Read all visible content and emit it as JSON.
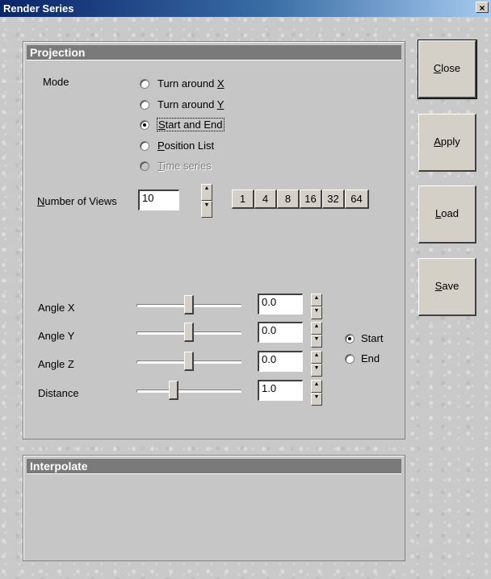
{
  "window": {
    "title": "Render Series",
    "close_glyph": "×"
  },
  "projection": {
    "header": "Projection",
    "mode_label": "Mode",
    "modes": [
      {
        "label_pre": "Turn around ",
        "mnemonic": "X",
        "label_post": "",
        "checked": false,
        "disabled": false
      },
      {
        "label_pre": "Turn around ",
        "mnemonic": "Y",
        "label_post": "",
        "checked": false,
        "disabled": false
      },
      {
        "label_pre": "",
        "mnemonic": "S",
        "label_post": "tart and End",
        "checked": true,
        "disabled": false
      },
      {
        "label_pre": "",
        "mnemonic": "P",
        "label_post": "osition List",
        "checked": false,
        "disabled": false
      },
      {
        "label_pre": "",
        "mnemonic": "T",
        "label_post": "ime series",
        "checked": false,
        "disabled": true
      }
    ],
    "views": {
      "label_mnemonic": "N",
      "label_rest": "umber of Views",
      "value": "10",
      "presets": [
        "1",
        "4",
        "8",
        "16",
        "32",
        "64"
      ]
    },
    "angles": [
      {
        "label": "Angle X",
        "value": "0.0",
        "level": 0.5
      },
      {
        "label": "Angle Y",
        "value": "0.0",
        "level": 0.5
      },
      {
        "label": "Angle Z",
        "value": "0.0",
        "level": 0.5
      },
      {
        "label": "Distance",
        "value": "1.0",
        "level": 0.35
      }
    ],
    "endpoint": {
      "start_label": "Start",
      "end_label": "End",
      "selected": "Start"
    }
  },
  "interpolate": {
    "header": "Interpolate"
  },
  "buttons": [
    {
      "mnemonic": "C",
      "rest": "lose"
    },
    {
      "mnemonic": "A",
      "rest": "pply"
    },
    {
      "mnemonic": "L",
      "rest": "oad"
    },
    {
      "mnemonic": "S",
      "rest": "ave"
    }
  ]
}
